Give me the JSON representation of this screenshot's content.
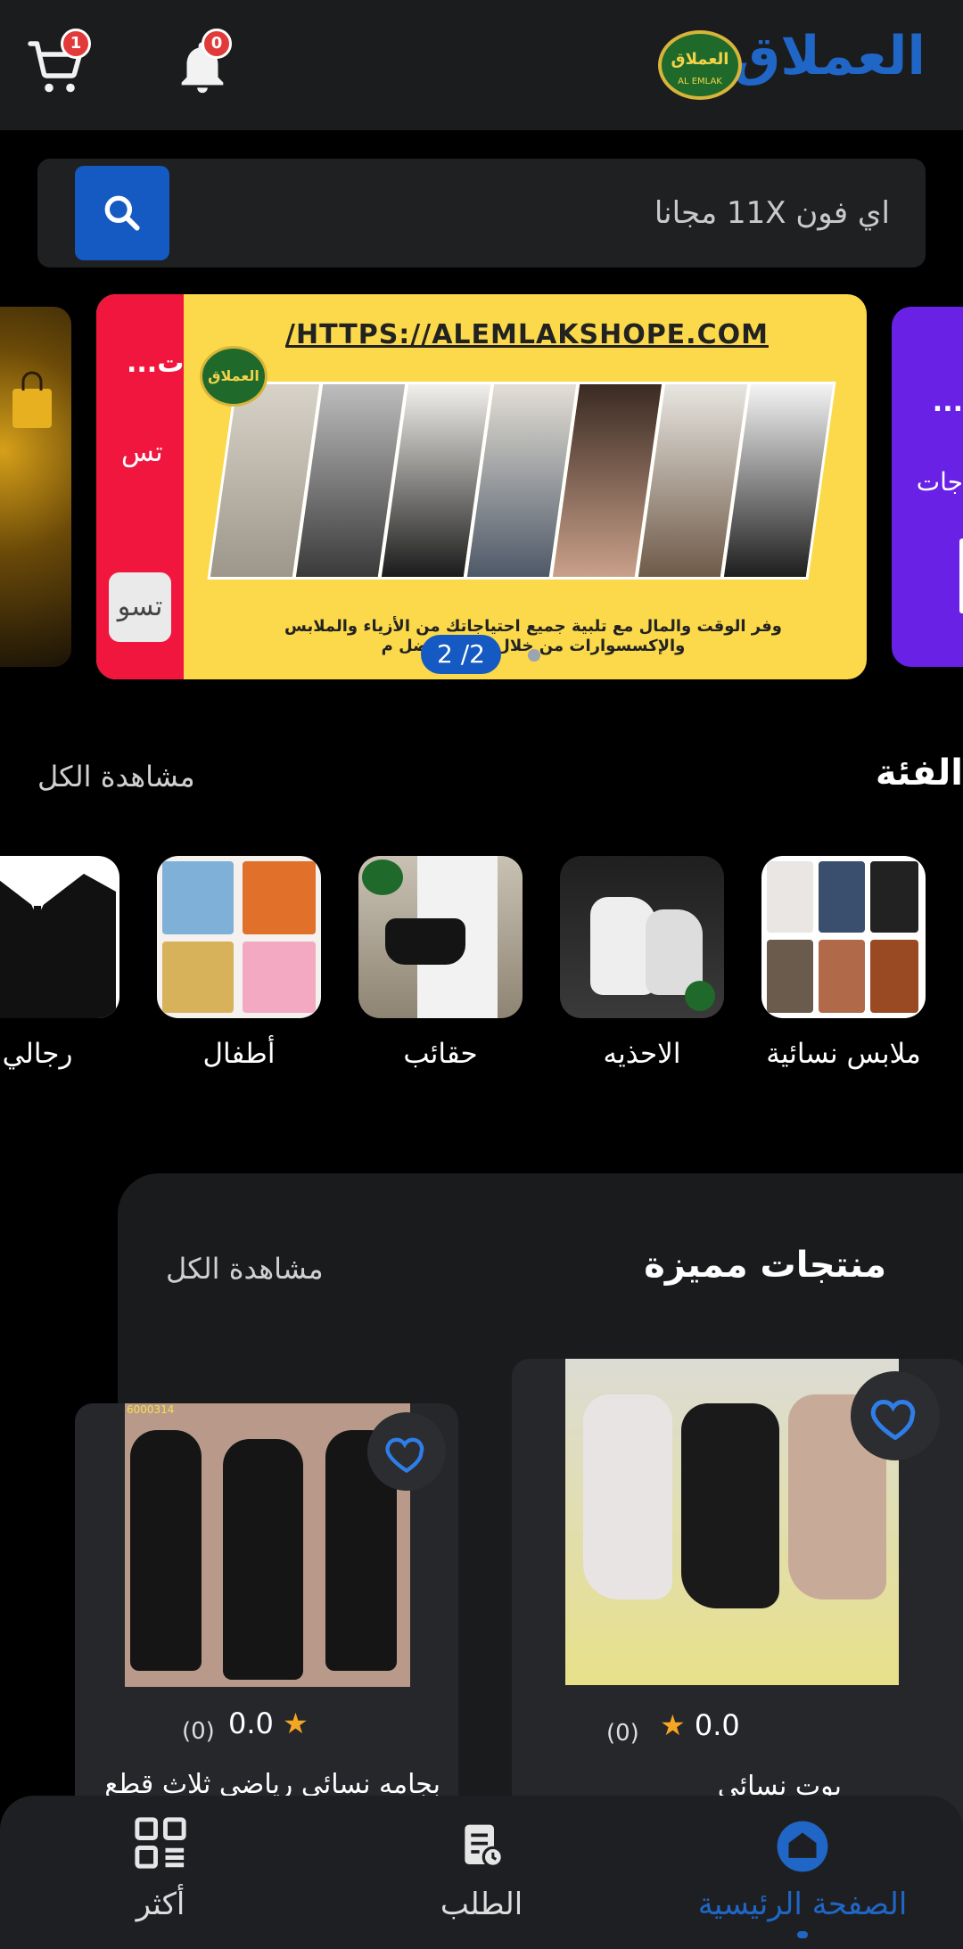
{
  "header": {
    "brand_name": "العملاق",
    "logo_text": "العملاق",
    "logo_sub": "AL EMLAK",
    "cart_count": "1",
    "notification_count": "0"
  },
  "search": {
    "value": "اي فون 11X مجانا"
  },
  "banner": {
    "url_text": "/HTTPS://ALEMLAKSHOPE.COM",
    "emblem_text": "العملاق",
    "description": "وفر الوقت والمال مع تلبية جميع احتياجاتك من الأزياء والملابس والإكسسوارات من خلال زيارة أفضل م",
    "counter": "2 /2",
    "side_line1": "ت...",
    "side_line2": "تس",
    "side_button": "تسو",
    "next_line1": "...",
    "next_line2": "جات"
  },
  "categories": {
    "title": "الفئة",
    "view_all": "مشاهدة الكل",
    "items": [
      {
        "label": "ملابس نسائية"
      },
      {
        "label": "الاحذيه"
      },
      {
        "label": "حقائب"
      },
      {
        "label": "أطفال"
      },
      {
        "label": "رجالي"
      }
    ]
  },
  "featured": {
    "title": "منتجات مميزة",
    "view_all": "مشاهدة الكل",
    "products": [
      {
        "rating": "0.0",
        "count": "(0)",
        "name": "بوت نسائي",
        "code": ""
      },
      {
        "rating": "0.0",
        "count": "(0)",
        "name": "بجامه نسائي رياضي ثلاث قطع",
        "code": "6000314"
      }
    ]
  },
  "bottom_nav": {
    "items": [
      {
        "label": "الصفحة الرئيسية"
      },
      {
        "label": "الطلب"
      },
      {
        "label": "أكثر"
      }
    ]
  },
  "colors": {
    "accent": "#1f66c7",
    "badge": "#e23a3a",
    "banner_yellow": "#fbd94a",
    "banner_red": "#f0163e",
    "banner_purple": "#6a21e6"
  }
}
